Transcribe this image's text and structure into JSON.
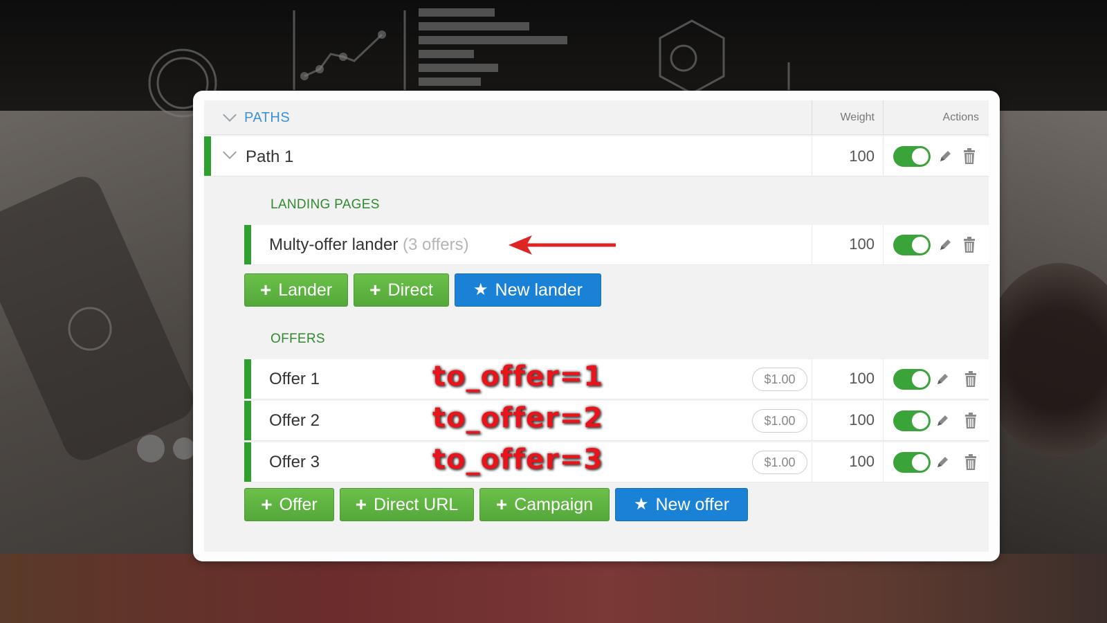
{
  "header": {
    "title": "PATHS",
    "weight_col": "Weight",
    "actions_col": "Actions"
  },
  "path": {
    "name": "Path 1",
    "weight": "100",
    "enabled": true
  },
  "landing_pages": {
    "label": "LANDING PAGES",
    "items": [
      {
        "name": "Multy-offer lander",
        "sub": "(3 offers)",
        "weight": "100",
        "enabled": true
      }
    ],
    "buttons": {
      "lander": "Lander",
      "direct": "Direct",
      "new_lander": "New lander"
    }
  },
  "offers": {
    "label": "OFFERS",
    "items": [
      {
        "name": "Offer 1",
        "price": "$1.00",
        "weight": "100",
        "annotation": "to_offer=1",
        "enabled": true
      },
      {
        "name": "Offer 2",
        "price": "$1.00",
        "weight": "100",
        "annotation": "to_offer=2",
        "enabled": true
      },
      {
        "name": "Offer 3",
        "price": "$1.00",
        "weight": "100",
        "annotation": "to_offer=3",
        "enabled": true
      }
    ],
    "buttons": {
      "offer": "Offer",
      "direct_url": "Direct URL",
      "campaign": "Campaign",
      "new_offer": "New offer"
    }
  },
  "colors": {
    "accent_green": "#2ea02e",
    "button_green": "#5db33f",
    "button_blue": "#1a82d6",
    "title_blue": "#3f8fd6",
    "annotation_red": "#e8141b"
  },
  "icons": {
    "collapse": "chevron-down-icon",
    "edit": "pencil-icon",
    "delete": "trash-icon",
    "add": "plus-icon",
    "new": "star-icon",
    "pointer": "red-arrow-icon"
  }
}
